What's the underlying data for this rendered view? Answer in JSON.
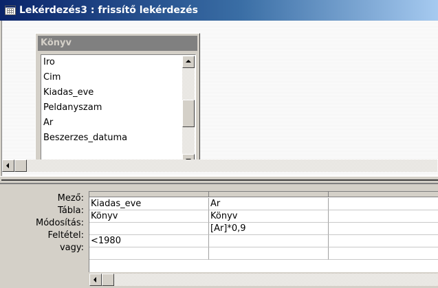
{
  "window": {
    "title": "Lekérdezés3 : frissítő lekérdezés"
  },
  "field_list": {
    "table_name": "Könyv",
    "fields": [
      "Iro",
      "Cim",
      "Kiadas_eve",
      "Peldanyszam",
      "Ar",
      "Beszerzes_datuma"
    ]
  },
  "grid": {
    "row_labels": {
      "field": "Mező:",
      "table": "Tábla:",
      "update_to": "Módosítás:",
      "criteria": "Feltétel:",
      "or": "vagy:"
    },
    "columns": [
      {
        "field": "Kiadas_eve",
        "table": "Könyv",
        "update_to": "",
        "criteria": "<1980",
        "or": ""
      },
      {
        "field": "Ar",
        "table": "Könyv",
        "update_to": "[Ar]*0,9",
        "criteria": "",
        "or": ""
      },
      {
        "field": "",
        "table": "",
        "update_to": "",
        "criteria": "",
        "or": ""
      }
    ]
  },
  "icons": {
    "title": "query-design-icon",
    "scroll_up": "arrow-up-icon",
    "scroll_down": "arrow-down-icon",
    "scroll_left": "arrow-left-icon"
  }
}
